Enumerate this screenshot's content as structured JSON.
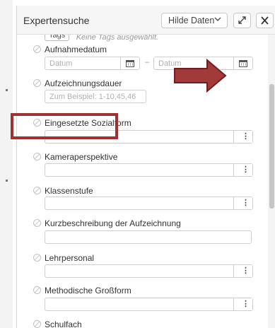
{
  "window": {
    "title": "Expertensuche",
    "toggle_label": "Hilde Daten",
    "toggle_icon": "chevron-down-icon",
    "expand_icon": "expand-icon",
    "close_icon": "close-icon"
  },
  "tags": {
    "chip": "Tags",
    "empty_text": "Keine Tags ausgewählt."
  },
  "fields": [
    {
      "label": "Aufnahmedatum",
      "from_placeholder": "Datum",
      "to_placeholder": "Datum",
      "separator": "–"
    },
    {
      "label": "Aufzeichnungsdauer",
      "placeholder": "Zum Beispiel: 1-10,45,46"
    },
    {
      "label": "Eingesetzte Sozialform"
    },
    {
      "label": "Kameraperspektive"
    },
    {
      "label": "Klassenstufe"
    },
    {
      "label": "Kurzbeschreibung der Aufzeichnung"
    },
    {
      "label": "Lehrpersonal"
    },
    {
      "label": "Methodische Großform"
    },
    {
      "label": "Schulfach"
    }
  ],
  "menu_glyph": "⋮",
  "colors": {
    "annotation": "#9e3131",
    "accent_border": "#cfcfcf"
  }
}
